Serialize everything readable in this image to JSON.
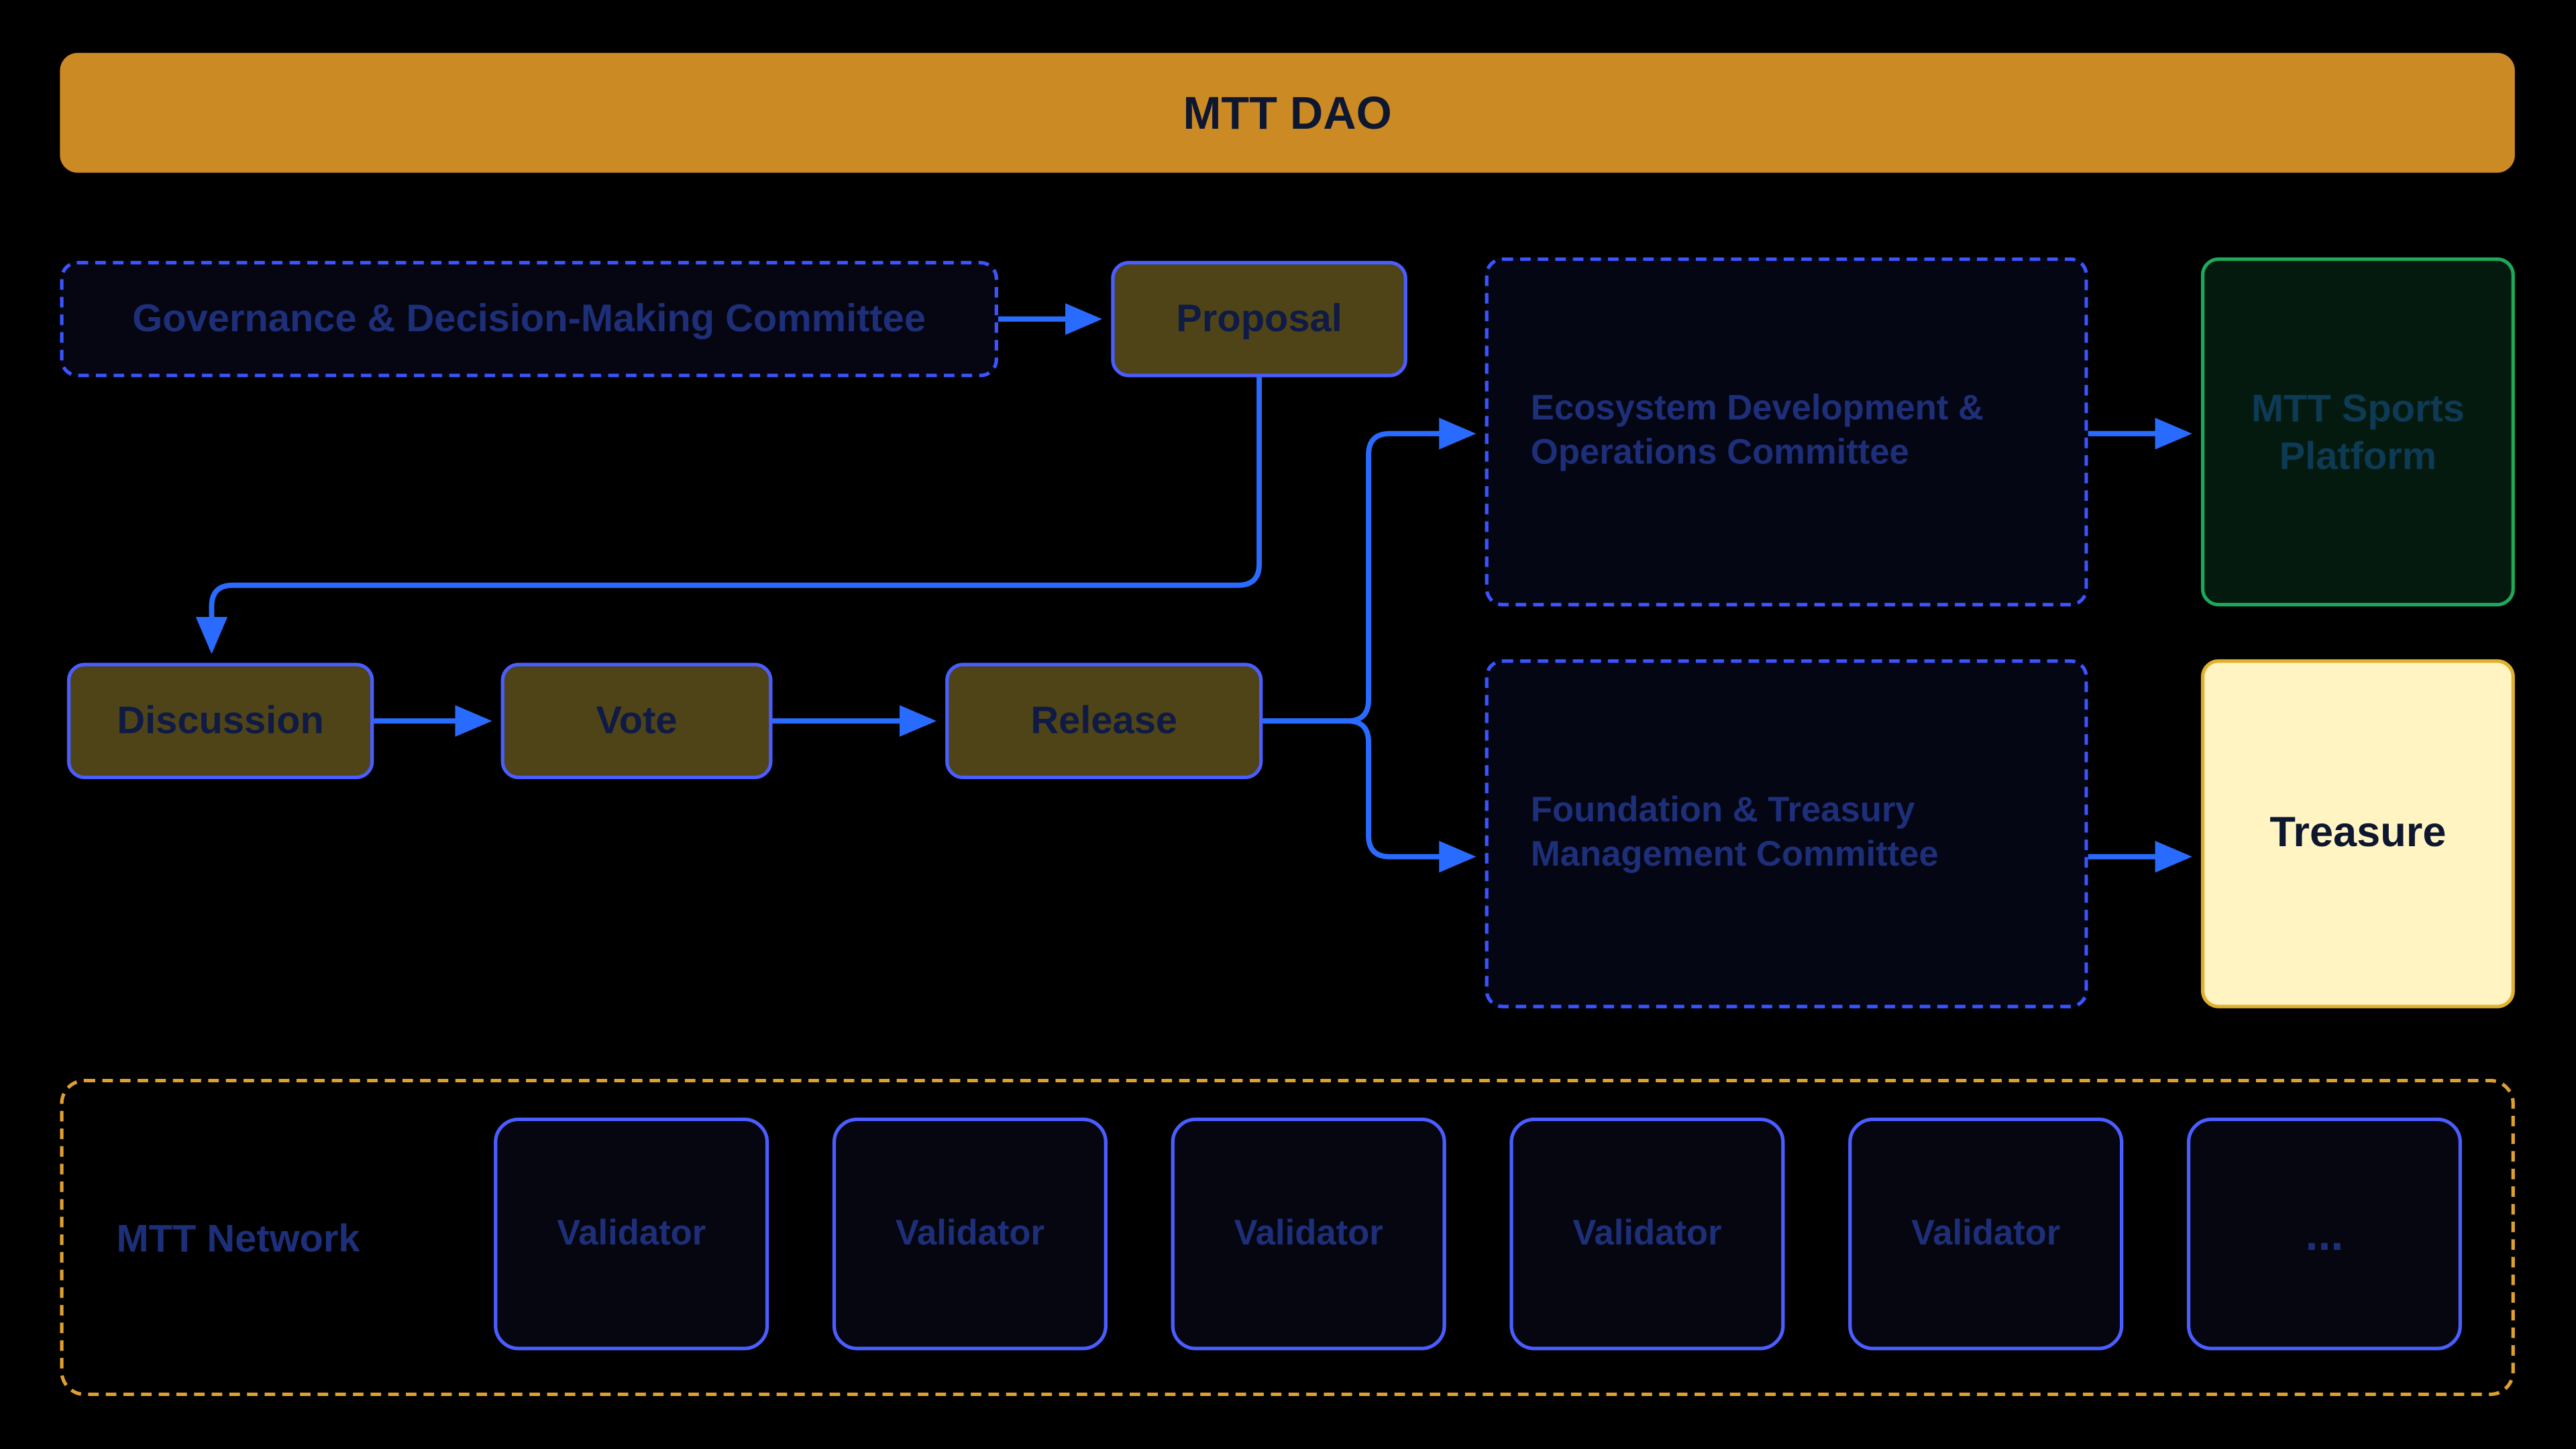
{
  "header": {
    "title": "MTT DAO"
  },
  "governance": {
    "label": "Governance & Decision-Making Committee"
  },
  "proposal": {
    "label": "Proposal"
  },
  "discussion": {
    "label": "Discussion"
  },
  "vote": {
    "label": "Vote"
  },
  "release": {
    "label": "Release"
  },
  "ecosystem": {
    "label": "Ecosystem Development & Operations Committee"
  },
  "foundation": {
    "label": "Foundation & Treasury Management Committee"
  },
  "sports": {
    "label": "MTT Sports Platform"
  },
  "treasure": {
    "label": "Treasure"
  },
  "network": {
    "label": "MTT Network",
    "items": [
      "Validator",
      "Validator",
      "Validator",
      "Validator",
      "Validator",
      "..."
    ]
  },
  "colors": {
    "bg": "#000000",
    "headerFill": "#cc8a24",
    "oliveFill": "#4e4418",
    "blueBorder": "#4a5dff",
    "blueDash": "#3a54ff",
    "blueArrow": "#2a6bff",
    "greenBorder": "#1ea85a",
    "treasureFill": "#fff4c2",
    "orangeDash": "#e0a030",
    "darkText": "#0e1730",
    "dimBlueText": "#1e2f7a"
  }
}
